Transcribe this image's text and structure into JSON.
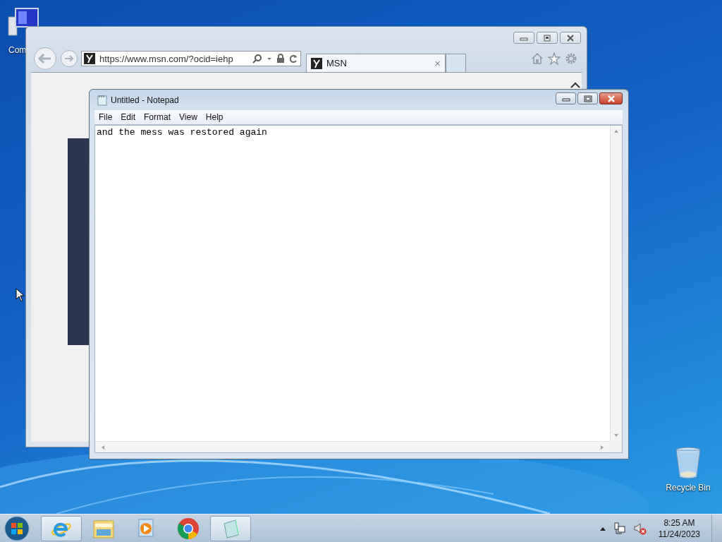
{
  "desktop_icons": [
    {
      "label": "Com",
      "kind": "computer"
    },
    {
      "label": "Recycle Bin",
      "kind": "recycle"
    }
  ],
  "browser": {
    "address": "https://www.msn.com/?ocid=iehp",
    "tab": {
      "label": "MSN",
      "close": "×"
    }
  },
  "notepad": {
    "title": "Untitled - Notepad",
    "menu": [
      "File",
      "Edit",
      "Format",
      "View",
      "Help"
    ],
    "text": "and the mess was restored again"
  },
  "taskbar": {
    "items": [
      {
        "kind": "ie",
        "running": true
      },
      {
        "kind": "explorer",
        "running": false
      },
      {
        "kind": "media",
        "running": false
      },
      {
        "kind": "chrome",
        "running": false
      },
      {
        "kind": "notepad",
        "running": true
      }
    ],
    "tray": {
      "time": "8:25 AM",
      "date": "11/24/2023"
    }
  }
}
